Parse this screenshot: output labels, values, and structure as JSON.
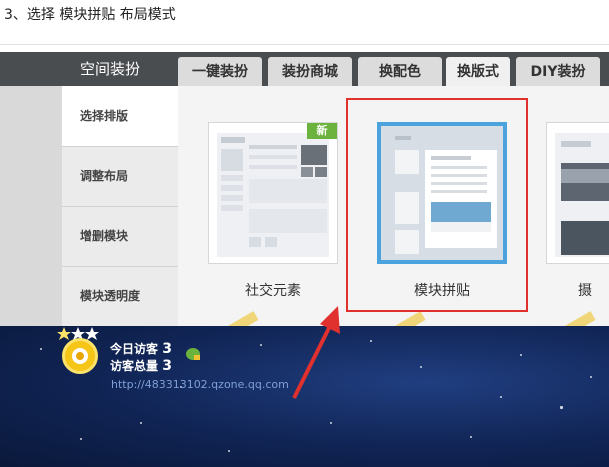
{
  "caption": "3、选择 模块拼贴 布局模式",
  "header": {
    "title": "空间装扮",
    "tabs": [
      {
        "label": "一键装扮"
      },
      {
        "label": "装扮商城"
      },
      {
        "label": "换配色"
      },
      {
        "label": "换版式",
        "active": true
      },
      {
        "label": "DIY装扮"
      }
    ]
  },
  "sidebar": {
    "items": [
      {
        "label": "选择排版",
        "active": true
      },
      {
        "label": "调整布局"
      },
      {
        "label": "增删模块"
      },
      {
        "label": "模块透明度"
      }
    ]
  },
  "layouts": [
    {
      "label": "社交元素",
      "badge": "新"
    },
    {
      "label": "模块拼贴",
      "selected": true
    },
    {
      "label": "摄"
    }
  ],
  "footer": {
    "visits_today_label": "今日访客",
    "visits_today_value": "3",
    "visits_total_label": "访客总量",
    "visits_total_value": "3",
    "url": "http://483313102.qzone.qq.com"
  },
  "colors": {
    "header_bg": "#4a4d50",
    "selection_outline": "#e0312f",
    "selected_card_border": "#4aa3dc",
    "badge": "#6cb33e",
    "arrow": "#e0312f"
  }
}
